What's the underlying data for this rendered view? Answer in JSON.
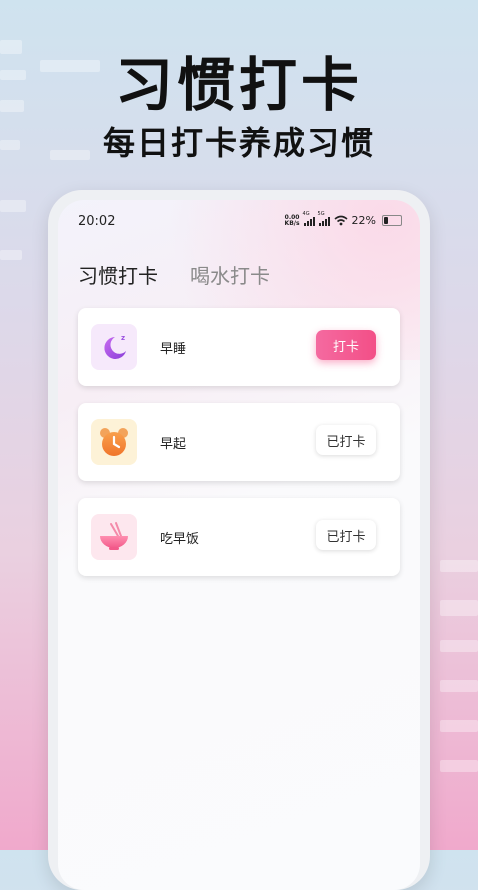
{
  "banner": {
    "title": "习惯打卡",
    "subtitle": "每日打卡养成习惯"
  },
  "status_bar": {
    "time": "20:02",
    "net_speed_value": "0.00",
    "net_speed_unit": "KB/s",
    "signal_1": "4G",
    "signal_2": "5G",
    "battery": "22%"
  },
  "tabs": [
    {
      "label": "习惯打卡",
      "active": true
    },
    {
      "label": "喝水打卡",
      "active": false
    }
  ],
  "habits": [
    {
      "name": "早睡",
      "icon": "moon-icon",
      "button": "打卡",
      "checked": false
    },
    {
      "name": "早起",
      "icon": "alarm-clock-icon",
      "button": "已打卡",
      "checked": true
    },
    {
      "name": "吃早饭",
      "icon": "bowl-icon",
      "button": "已打卡",
      "checked": true
    }
  ],
  "colors": {
    "accent": "#f34f87",
    "sleep_icon_bg": "#f6e9fb",
    "wake_icon_bg": "#fdf2d7",
    "meal_icon_bg": "#fde7ee"
  }
}
